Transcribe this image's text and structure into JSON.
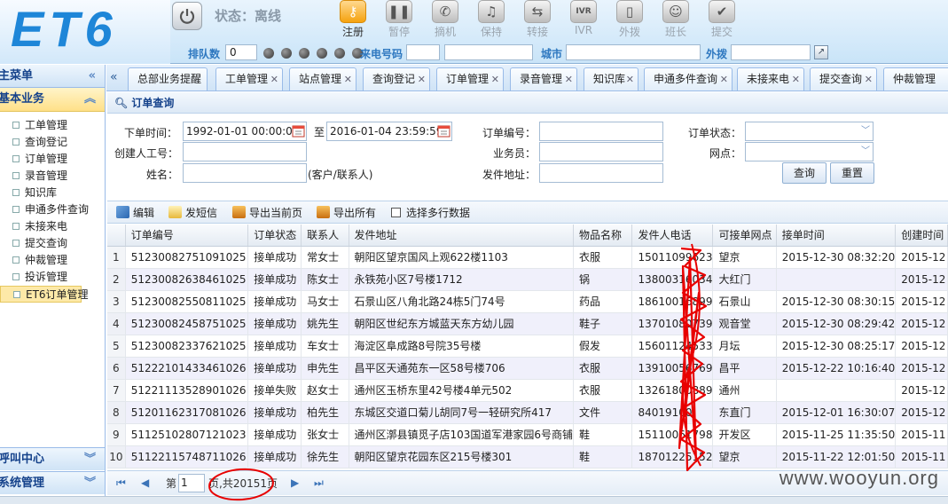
{
  "header": {
    "logo": "ET6",
    "status": "状态：离线",
    "tools": [
      {
        "label": "注册",
        "icon": "key-icon",
        "active": true
      },
      {
        "label": "暂停",
        "icon": "pause-icon",
        "active": false
      },
      {
        "label": "摘机",
        "icon": "phone-pickup-icon",
        "active": false
      },
      {
        "label": "保持",
        "icon": "music-note-icon",
        "active": false
      },
      {
        "label": "转接",
        "icon": "transfer-icon",
        "active": false
      },
      {
        "label": "IVR",
        "icon": "ivr-icon",
        "active": false
      },
      {
        "label": "外拨",
        "icon": "mobile-phone-icon",
        "active": false
      },
      {
        "label": "班长",
        "icon": "supervisor-icon",
        "active": false
      },
      {
        "label": "提交",
        "icon": "checkmark-icon",
        "active": false
      }
    ],
    "queue_label": "排队数",
    "queue_value": "0",
    "incoming_label": "来电号码",
    "incoming_value": "",
    "city_label": "城市",
    "city_value": "",
    "dial_label": "外拨",
    "dial_value": ""
  },
  "sidebar": {
    "main_menu": "主菜单",
    "basic_business": "基本业务",
    "items": [
      {
        "label": "工单管理",
        "selected": false
      },
      {
        "label": "查询登记",
        "selected": false
      },
      {
        "label": "订单管理",
        "selected": false
      },
      {
        "label": "录音管理",
        "selected": false
      },
      {
        "label": "知识库",
        "selected": false
      },
      {
        "label": "申通多件查询",
        "selected": false
      },
      {
        "label": "未接来电",
        "selected": false
      },
      {
        "label": "提交查询",
        "selected": false
      },
      {
        "label": "仲裁管理",
        "selected": false
      },
      {
        "label": "投诉管理",
        "selected": false
      },
      {
        "label": "ET6订单管理",
        "selected": true
      }
    ],
    "call_center": "呼叫中心",
    "system_mgmt": "系统管理"
  },
  "tabs": [
    "总部业务提醒",
    "工单管理",
    "站点管理",
    "查询登记",
    "订单管理",
    "录音管理",
    "知识库",
    "申通多件查询",
    "未接来电",
    "提交查询",
    "仲裁管理"
  ],
  "query": {
    "title": "订单查询",
    "order_time_label": "下单时间：",
    "order_time_from": "1992-01-01 00:00:00",
    "to_label": "至",
    "order_time_to": "2016-01-04 23:59:59",
    "creator_label": "创建人工号：",
    "creator_value": "",
    "name_label": "姓名：",
    "name_value": "",
    "name_hint": "(客户/联系人)",
    "order_no_label": "订单编号：",
    "salesman_label": "业务员：",
    "sender_addr_label": "发件地址：",
    "status_label": "订单状态：",
    "site_label": "网点：",
    "search_btn": "查询",
    "reset_btn": "重置"
  },
  "toolbar": {
    "edit": "编辑",
    "sms": "发短信",
    "export_page": "导出当前页",
    "export_all": "导出所有",
    "multi_select": "选择多行数据"
  },
  "grid": {
    "columns": [
      "订单编号",
      "订单状态",
      "联系人",
      "发件地址",
      "物品名称",
      "发件人电话",
      "可接单网点",
      "接单时间",
      "创建时间"
    ],
    "rows": [
      [
        "1",
        "51230082751091025",
        "接单成功",
        "常女士",
        "朝阳区望京国风上观622楼1103",
        "衣服",
        "15011099623",
        "望京",
        "2015-12-30 08:32:20",
        "2015-12"
      ],
      [
        "2",
        "51230082638461025",
        "接单成功",
        "陈女士",
        "永铁苑小区7号楼1712",
        "锅",
        "13800316034",
        "大红门",
        "",
        "2015-12"
      ],
      [
        "3",
        "51230082550811025",
        "接单成功",
        "马女士",
        "石景山区八角北路24栋5门74号",
        "药品",
        "18610016899",
        "石景山",
        "2015-12-30 08:30:15",
        "2015-12"
      ],
      [
        "4",
        "51230082458751025",
        "接单成功",
        "姚先生",
        "朝阳区世纪东方城蓝天东方幼儿园",
        "鞋子",
        "13701080739",
        "观音堂",
        "2015-12-30 08:29:42",
        "2015-12"
      ],
      [
        "5",
        "51230082337621025",
        "接单成功",
        "车女士",
        "海淀区阜成路8号院35号楼",
        "假发",
        "15601124533",
        "月坛",
        "2015-12-30 08:25:17",
        "2015-12"
      ],
      [
        "6",
        "51222101433461026",
        "接单成功",
        "申先生",
        "昌平区天通苑东一区58号楼706",
        "衣服",
        "13910056769",
        "昌平",
        "2015-12-22 10:16:40",
        "2015-12"
      ],
      [
        "7",
        "51221113528901026",
        "接单失败",
        "赵女士",
        "通州区玉桥东里42号楼4单元502",
        "衣服",
        "13261800889",
        "通州",
        "",
        "2015-12"
      ],
      [
        "8",
        "51201162317081026",
        "接单成功",
        "柏先生",
        "东城区交道口菊儿胡同7号一轻研究所417",
        "文件",
        "84019100",
        "东直门",
        "2015-12-01 16:30:07",
        "2015-12"
      ],
      [
        "9",
        "51125102807121023",
        "接单成功",
        "张女士",
        "通州区漷县镇觅子店103国道军港家园6号商铺",
        "鞋",
        "15110061798",
        "开发区",
        "2015-11-25 11:35:50",
        "2015-11"
      ],
      [
        "10",
        "51122115748711026",
        "接单成功",
        "徐先生",
        "朝阳区望京花园东区215号楼301",
        "鞋",
        "18701225152",
        "望京",
        "2015-11-22 12:01:50",
        "2015-11"
      ]
    ]
  },
  "pager": {
    "page_prefix": "第",
    "page_value": "1",
    "page_suffix": "页,共20151页"
  },
  "watermark": "www.wooyun.org",
  "colors": {
    "accent": "#15428b",
    "link_blue": "#2e78c0",
    "scribble_red": "#e80000"
  }
}
